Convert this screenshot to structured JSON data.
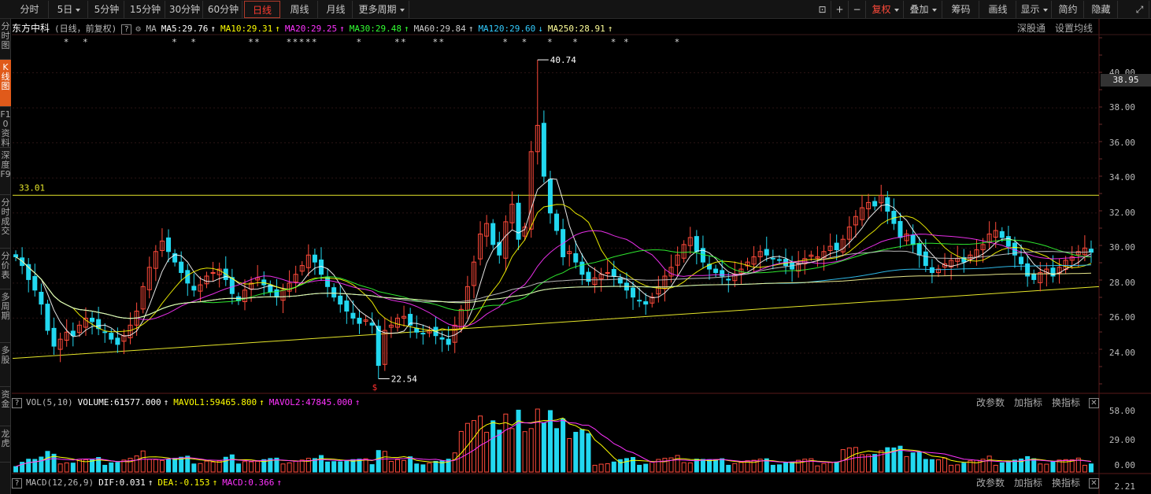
{
  "toolbar": {
    "periods": [
      "分时",
      "5日",
      "5分钟",
      "15分钟",
      "30分钟",
      "60分钟",
      "日线",
      "周线",
      "月线",
      "更多周期"
    ],
    "active_period": "日线",
    "right": [
      "复权",
      "叠加",
      "筹码",
      "画线",
      "显示",
      "简约",
      "隐藏"
    ],
    "icons": [
      "lock-icon",
      "plus-icon",
      "minus-icon"
    ]
  },
  "side_tabs": [
    "分时图",
    "K线图",
    "F10资料",
    "深度F9",
    "分时成交",
    "分价表",
    "多周期",
    "多股",
    "资金",
    "龙虎"
  ],
  "main_header": {
    "stock": "东方中科",
    "mode": "(日线，前复权)",
    "ma_label": "MA",
    "ma": [
      {
        "text": "MA5:29.76",
        "arrow": "↑",
        "color": "#ffffff"
      },
      {
        "text": "MA10:29.31",
        "arrow": "↑",
        "color": "#ffff00"
      },
      {
        "text": "MA20:29.25",
        "arrow": "↑",
        "color": "#ff33ff"
      },
      {
        "text": "MA30:29.48",
        "arrow": "↑",
        "color": "#33ff33"
      },
      {
        "text": "MA60:29.84",
        "arrow": "↑",
        "color": "#cccccc"
      },
      {
        "text": "MA120:29.60",
        "arrow": "↓",
        "color": "#33ccff"
      },
      {
        "text": "MA250:28.91",
        "arrow": "↑",
        "color": "#ffff99"
      }
    ],
    "links": [
      "深股通",
      "设置均线"
    ]
  },
  "annotations": {
    "high": "40.74",
    "low": "22.54",
    "hline": "33.01",
    "last_price": "38.95"
  },
  "price_axis": [
    "40.00",
    "38.00",
    "36.00",
    "34.00",
    "32.00",
    "30.00",
    "28.00",
    "26.00",
    "24.00"
  ],
  "vol_header": {
    "label": "VOL(5,10)",
    "items": [
      {
        "text": "VOLUME:61577.000",
        "arrow": "↑",
        "color": "#ffffff"
      },
      {
        "text": "MAVOL1:59465.800",
        "arrow": "↑",
        "color": "#ffff00"
      },
      {
        "text": "MAVOL2:47845.000",
        "arrow": "↑",
        "color": "#ff33ff"
      }
    ],
    "links": [
      "改参数",
      "加指标",
      "换指标"
    ]
  },
  "vol_axis": [
    "58.00",
    "29.00",
    "0.00"
  ],
  "macd_header": {
    "label": "MACD(12,26,9)",
    "items": [
      {
        "text": "DIF:0.031",
        "arrow": "↑",
        "color": "#ffffff"
      },
      {
        "text": "DEA:-0.153",
        "arrow": "↑",
        "color": "#ffff00"
      },
      {
        "text": "MACD:0.366",
        "arrow": "↑",
        "color": "#ff33ff"
      }
    ],
    "links": [
      "改参数",
      "加指标",
      "换指标"
    ]
  },
  "macd_axis": [
    "2.21"
  ],
  "colors": {
    "up": "#ff4a3a",
    "down": "#22d8f0",
    "bg": "#000000"
  },
  "chart_data": {
    "type": "candlestick",
    "y_range": [
      21.8,
      42.0
    ],
    "close": [
      29.5,
      29.0,
      28.2,
      27.6,
      26.8,
      25.3,
      24.4,
      24.8,
      25.2,
      25.0,
      25.6,
      26.0,
      25.8,
      25.4,
      25.2,
      24.8,
      24.5,
      25.0,
      25.6,
      26.4,
      27.8,
      28.9,
      29.8,
      30.4,
      29.8,
      29.2,
      28.6,
      28.0,
      27.6,
      27.9,
      28.4,
      28.6,
      28.8,
      28.2,
      27.4,
      27.0,
      27.6,
      28.0,
      28.3,
      27.9,
      27.5,
      27.2,
      27.6,
      28.0,
      28.5,
      29.0,
      29.6,
      29.2,
      28.5,
      27.8,
      27.2,
      26.8,
      26.4,
      26.0,
      25.7,
      25.9,
      25.6,
      23.3,
      25.3,
      25.6,
      26.0,
      26.1,
      25.6,
      25.2,
      25.1,
      25.3,
      25.0,
      24.8,
      24.5,
      25.6,
      26.5,
      27.8,
      29.2,
      30.8,
      31.4,
      30.2,
      29.6,
      31.5,
      32.5,
      30.5,
      31.2,
      35.5,
      37.0,
      34.1,
      32.0,
      31.0,
      29.5,
      29.8,
      29.2,
      28.5,
      28.1,
      28.3,
      28.5,
      28.6,
      28.4,
      28.0,
      27.6,
      27.2,
      27.0,
      26.8,
      27.2,
      27.8,
      28.4,
      28.9,
      29.6,
      30.2,
      30.6,
      29.8,
      29.2,
      28.8,
      28.6,
      28.4,
      28.2,
      28.5,
      28.8,
      29.2,
      29.5,
      29.8,
      29.6,
      29.4,
      29.3,
      29.0,
      28.8,
      29.1,
      29.4,
      29.6,
      29.5,
      29.8,
      30.1,
      29.9,
      30.5,
      31.2,
      31.8,
      32.3,
      32.6,
      32.4,
      33.0,
      32.1,
      31.4,
      30.6,
      30.8,
      30.2,
      29.6,
      29.0,
      28.6,
      28.8,
      29.1,
      29.3,
      29.4,
      29.2,
      29.6,
      29.9,
      30.2,
      30.8,
      31.0,
      30.6,
      30.1,
      29.6,
      29.1,
      28.4,
      28.2,
      28.6,
      28.8,
      28.4,
      28.9,
      29.3,
      29.5,
      29.8,
      30.0,
      29.76
    ],
    "volume_max": 58,
    "macd_value": 2.21
  }
}
